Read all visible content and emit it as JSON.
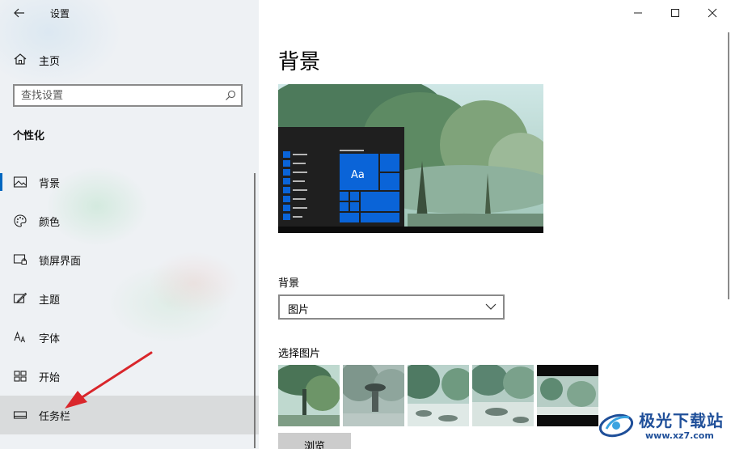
{
  "window": {
    "title": "设置",
    "controls": {
      "minimize": "minimize",
      "maximize": "maximize",
      "close": "close"
    }
  },
  "sidebar": {
    "home_label": "主页",
    "search_placeholder": "查找设置",
    "section_title": "个性化",
    "items": [
      {
        "label": "背景",
        "icon": "picture-icon",
        "active": true
      },
      {
        "label": "颜色",
        "icon": "palette-icon",
        "active": false
      },
      {
        "label": "锁屏界面",
        "icon": "lock-screen-icon",
        "active": false
      },
      {
        "label": "主题",
        "icon": "theme-brush-icon",
        "active": false
      },
      {
        "label": "字体",
        "icon": "font-icon",
        "active": false
      },
      {
        "label": "开始",
        "icon": "start-grid-icon",
        "active": false
      },
      {
        "label": "任务栏",
        "icon": "taskbar-icon",
        "active": false,
        "hovered": true
      }
    ]
  },
  "main": {
    "page_title": "背景",
    "preview_tile_text": "Aa",
    "background_label": "背景",
    "background_value": "图片",
    "choose_label": "选择图片",
    "thumbnails": [
      "willow-tree-scene",
      "rain-umbrella-scene",
      "mountain-river-scene",
      "waterfall-rocks-scene",
      "landscape-black-bars-scene"
    ],
    "browse_label": "浏览"
  },
  "watermark": {
    "title": "极光下载站",
    "url": "www.xz7.com"
  },
  "colors": {
    "accent": "#0067c0",
    "tile_blue": "#0a64d8",
    "arrow_red": "#d9262b",
    "watermark_blue": "#1f4f99"
  }
}
